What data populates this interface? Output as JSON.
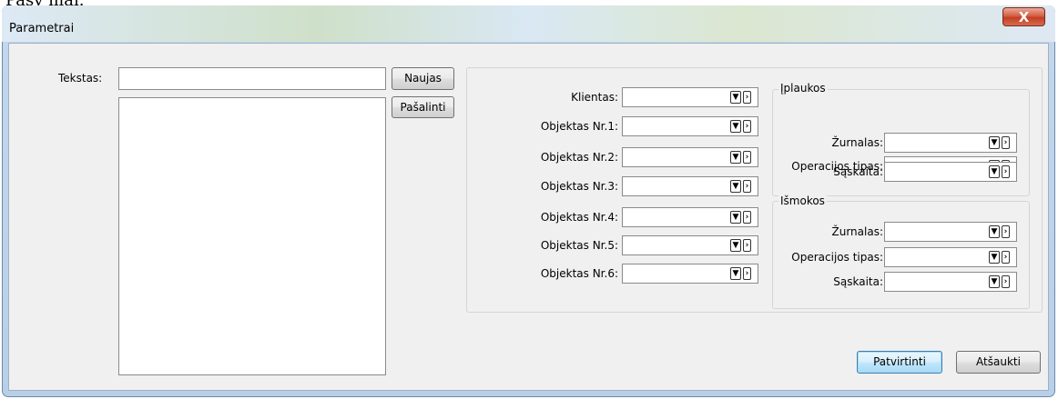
{
  "background_partial_text": "Pasy mai.",
  "window": {
    "title": "Parametrai",
    "close_label": "X"
  },
  "left": {
    "text_label": "Tekstas:",
    "text_value": "",
    "new_button": "Naujas",
    "delete_button": "Pašalinti"
  },
  "main_fields": [
    {
      "label": "Klientas:",
      "value": ""
    },
    {
      "label": "Objektas Nr.1:",
      "value": ""
    },
    {
      "label": "Objektas Nr.2:",
      "value": ""
    },
    {
      "label": "Objektas Nr.3:",
      "value": ""
    },
    {
      "label": "Objektas Nr.4:",
      "value": ""
    },
    {
      "label": "Objektas Nr.5:",
      "value": ""
    },
    {
      "label": "Objektas Nr.6:",
      "value": ""
    }
  ],
  "incomes": {
    "title": "Įplaukos",
    "fields": [
      {
        "label": "Žurnalas:",
        "value": ""
      },
      {
        "label": "Operacijos tipas:",
        "value": ""
      },
      {
        "label": "Sąskaita:",
        "value": ""
      }
    ]
  },
  "payouts": {
    "title": "Išmokos",
    "fields": [
      {
        "label": "Žurnalas:",
        "value": ""
      },
      {
        "label": "Operacijos tipas:",
        "value": ""
      },
      {
        "label": "Sąskaita:",
        "value": ""
      }
    ]
  },
  "footer": {
    "confirm": "Patvirtinti",
    "cancel": "Atšaukti"
  },
  "icons": {
    "dropdown": "dropdown-arrow-icon",
    "next": "next-arrow-icon"
  }
}
